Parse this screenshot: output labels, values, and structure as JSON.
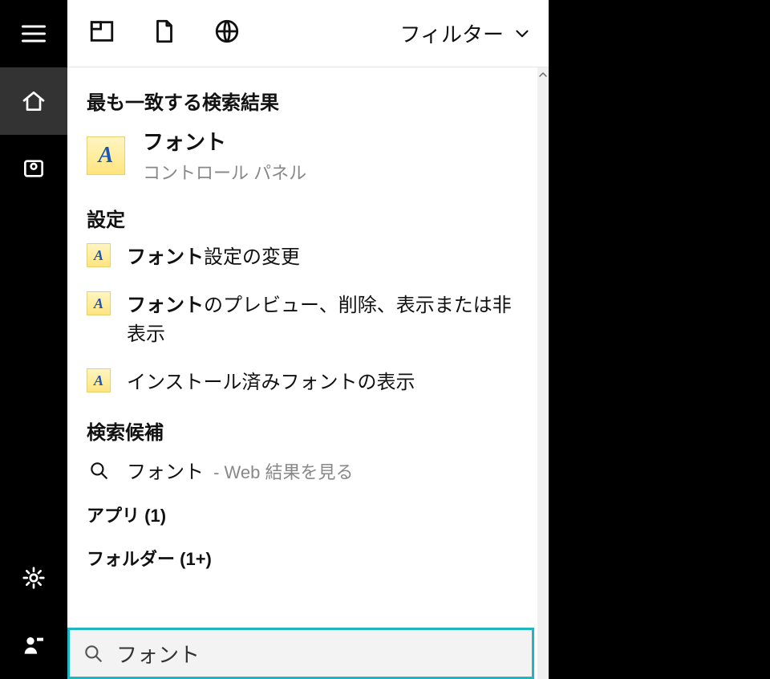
{
  "rail": {
    "items": [
      {
        "name": "menu",
        "icon": "hamburger"
      },
      {
        "name": "home",
        "icon": "home",
        "active": true
      },
      {
        "name": "timeline",
        "icon": "camera"
      },
      {
        "name": "settings",
        "icon": "gear"
      },
      {
        "name": "account",
        "icon": "person"
      }
    ]
  },
  "filter": {
    "label": "フィルター"
  },
  "sections": {
    "best_match_header": "最も一致する検索結果",
    "settings_header": "設定",
    "suggestions_header": "検索候補"
  },
  "best_match": {
    "title": "フォント",
    "subtitle": "コントロール パネル",
    "icon_glyph": "A"
  },
  "settings_items": [
    {
      "bold": "フォント",
      "rest": "設定の変更",
      "icon_glyph": "A"
    },
    {
      "bold": "フォント",
      "rest": "のプレビュー、削除、表示または非表示",
      "icon_glyph": "A"
    },
    {
      "bold": "",
      "rest": "インストール済みフォントの表示",
      "icon_glyph": "A"
    }
  ],
  "web_suggestion": {
    "query": "フォント",
    "suffix": " - Web 結果を見る"
  },
  "categories": {
    "apps": {
      "label": "アプリ",
      "count": "(1)"
    },
    "folders": {
      "label": "フォルダー",
      "count": "(1+)"
    }
  },
  "search_input": {
    "value": "フォント"
  }
}
